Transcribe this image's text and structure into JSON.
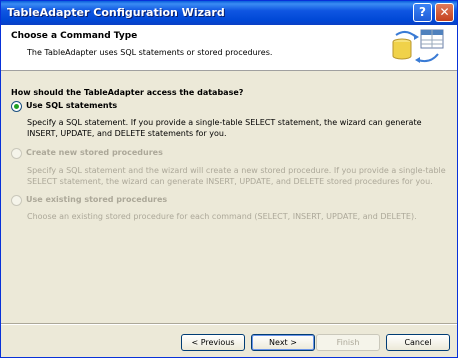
{
  "window": {
    "title": "TableAdapter Configuration Wizard",
    "help_symbol": "?",
    "close_symbol": "✕"
  },
  "header": {
    "title": "Choose a Command Type",
    "description": "The TableAdapter uses SQL statements or stored procedures.",
    "icon": "database-table-graphic"
  },
  "question": "How should the TableAdapter access the database?",
  "options": [
    {
      "label": "Use SQL statements",
      "selected": true,
      "enabled": true,
      "description": "Specify a SQL statement. If you provide a single-table SELECT statement, the wizard can generate INSERT, UPDATE, and DELETE statements for you."
    },
    {
      "label": "Create new stored procedures",
      "selected": false,
      "enabled": false,
      "description": "Specify a SQL statement and the wizard will create a new stored procedure. If you provide a single-table SELECT statement, the wizard can generate INSERT, UPDATE, and DELETE stored procedures for you."
    },
    {
      "label": "Use existing stored procedures",
      "selected": false,
      "enabled": false,
      "description": "Choose an existing stored procedure for each command (SELECT, INSERT, UPDATE, and DELETE)."
    }
  ],
  "buttons": {
    "previous": "< Previous",
    "next": "Next >",
    "finish": "Finish",
    "cancel": "Cancel"
  }
}
